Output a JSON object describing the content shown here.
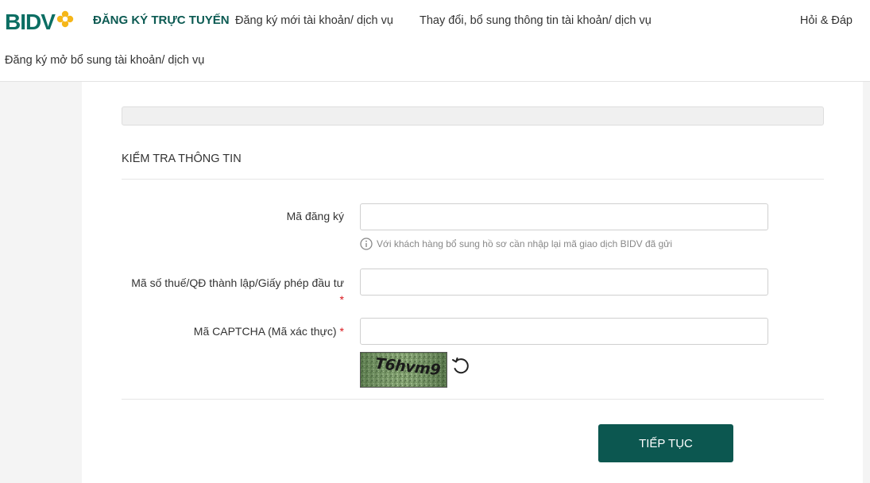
{
  "header": {
    "logo_text": "BIDV",
    "brand_title": "ĐĂNG KÝ TRỰC TUYẾN",
    "nav": [
      {
        "label": "Đăng ký mới tài khoản/ dịch vụ"
      },
      {
        "label": "Thay đổi, bổ sung thông tin tài khoản/ dịch vụ"
      },
      {
        "label": "Đăng ký mở bổ sung tài khoản/ dịch vụ"
      }
    ],
    "faq": "Hỏi & Đáp"
  },
  "form": {
    "section_title": "KIỂM TRA THÔNG TIN",
    "registration_code": {
      "label": "Mã đăng ký",
      "value": "",
      "hint": "Với khách hàng bổ sung hồ sơ cần nhập lại mã giao dịch BIDV đã gửi"
    },
    "tax_code": {
      "label": "Mã số thuế/QĐ thành lập/Giấy phép đầu tư",
      "required_mark": "*",
      "value": ""
    },
    "captcha": {
      "label": "Mã CAPTCHA (Mã xác thực)",
      "required_mark": "*",
      "value": "",
      "image_text": "T6hvm9"
    },
    "submit_label": "TIẾP TỤC"
  },
  "colors": {
    "brand": "#0b6e63",
    "button": "#0c5750",
    "required": "#d9161c",
    "logo_flower": "#f5b619"
  },
  "icons": {
    "hint": "info-circle-icon",
    "refresh": "refresh-icon"
  }
}
